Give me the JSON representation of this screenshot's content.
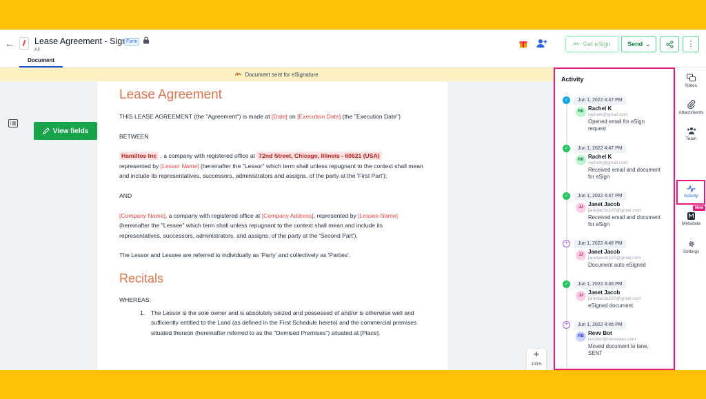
{
  "header": {
    "title": "Lease Agreement - Sign",
    "badge": "Form",
    "subtitle": "All",
    "tab": "Document"
  },
  "toolbar": {
    "esign_label": "Get eSign",
    "send_label": "Send"
  },
  "banner": {
    "text": "Document sent for eSignature"
  },
  "sidebar_btn": {
    "view_fields": "View fields"
  },
  "document": {
    "title": "Lease Agreement",
    "p1_a": "THIS LEASE AGREEMENT (the \"Agreement\") is made at ",
    "p1_date": "[Date]",
    "p1_on": " on ",
    "p1_exec": "[Execution Date]",
    "p1_b": " (the \"Execution Date\")",
    "between": "BETWEEN",
    "lessor_name": "Hamiltos Inc",
    "p2_a": " , a company with registered office at ",
    "lessor_addr": "72nd Street,  Chicago, Illinois - 60621 (USA)",
    "p2_b": "represented by ",
    "lessor_rep": "[Lessor Name]",
    "p2_c": " (hereinafter the \"Lessor\" which term shall unless repugnant to the context shall mean and include its representatives, successors, administrators and assigns, of the party at the 'First Part');",
    "and": "AND",
    "company_name": "[Company Name]",
    "p3_a": ", a company with registered office at ",
    "company_addr": "[Company Address]",
    "p3_b": ", represented by ",
    "lessee_name": "[Lessee Name]",
    "p3_c": " (hereinafter the \"Lessee\" which term shall unless repugnant to the context shall mean and include its representatives, successors, administrators, and assigns, of the party at the 'Second Part').",
    "p4": "The Lessor and Lessee are referred to individually as 'Party' and collectively as 'Parties'.",
    "recitals": "Recitals",
    "whereas": "WHEREAS:",
    "item1_num": "1.",
    "item1": "The Lessor is the sole owner and is absolutely seized and possessed of and/or is otherwise well and sufficiently entitled to the Land (as defined in the First Schedule hereto) and the commercial premises situated thereon (hereinafter referred to as the \"Demised Premises\") situated at [Place]."
  },
  "zoom": {
    "plus": "+",
    "level": "100%",
    "minus": "−"
  },
  "activity": {
    "title": "Activity",
    "entries": [
      {
        "date": "Jun 1, 2022 4:47 PM",
        "initials": "RK",
        "name": "Rachel K",
        "email": "rachelk@gmail.com",
        "desc": "Opened email for eSign request"
      },
      {
        "date": "Jun 1, 2022 4:47 PM",
        "initials": "RK",
        "name": "Rachel K",
        "email": "rachelk@gmail.com",
        "desc": "Received email and document for eSign"
      },
      {
        "date": "Jun 1, 2022 4:47 PM",
        "initials": "JJ",
        "name": "Janet Jacob",
        "email": "janetjacob197@gmail.com",
        "desc": "Received email and document for eSign"
      },
      {
        "date": "Jun 1, 2022 4:46 PM",
        "initials": "JJ",
        "name": "Janet Jacob",
        "email": "janetjacob197@gmail.com",
        "desc": "Document auto eSigned"
      },
      {
        "date": "Jun 1, 2022 4:46 PM",
        "initials": "JJ",
        "name": "Janet Jacob",
        "email": "janetjacob197@gmail.com",
        "desc": "eSigned document"
      },
      {
        "date": "Jun 1, 2022 4:46 PM",
        "initials": "RB",
        "name": "Revv Bot",
        "email": "revvbot@revvsales.com",
        "desc": "Moved document to lane, SENT"
      }
    ]
  },
  "rail": {
    "notes": "Notes",
    "attachments": "Attachments",
    "team": "Team",
    "activity": "Activity",
    "new_badge": "New",
    "metadata": "Metadata",
    "settings": "Settings"
  }
}
